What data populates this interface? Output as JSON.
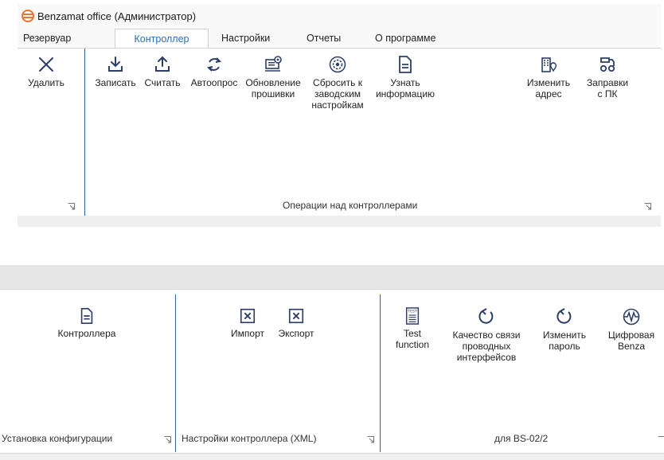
{
  "window": {
    "title": "Benzamat office (Администратор)"
  },
  "tabs": [
    {
      "label": "Резервуар",
      "active": false
    },
    {
      "label": "Контроллер",
      "active": true
    },
    {
      "label": "Настройки",
      "active": false
    },
    {
      "label": "Отчеты",
      "active": false
    },
    {
      "label": "О программе",
      "active": false
    }
  ],
  "ribbon_top": {
    "delete_label": "Удалить",
    "buttons": [
      {
        "label": "Записать",
        "icon": "download-icon"
      },
      {
        "label": "Считать",
        "icon": "upload-icon"
      },
      {
        "label": "Автоопрос",
        "icon": "refresh-icon"
      },
      {
        "label": "Обновление\nпрошивки",
        "icon": "firmware-icon"
      },
      {
        "label": "Сбросить к\nзаводским\nнастройкам",
        "icon": "factory-reset-icon"
      },
      {
        "label": "Узнать\nинформацию",
        "icon": "info-document-icon"
      },
      {
        "label": "Изменить\nадрес",
        "icon": "address-building-icon"
      },
      {
        "label": "Заправки\nс ПК",
        "icon": "fuel-dispenser-icon"
      }
    ],
    "group_label": "Операции над контроллерами"
  },
  "ribbon_bottom": {
    "groups": [
      {
        "label": "Установка конфигурации",
        "buttons": [
          {
            "label": "Контроллера",
            "icon": "document-icon"
          }
        ]
      },
      {
        "label": "Настройки контроллера (XML)",
        "buttons": [
          {
            "label": "Импорт",
            "icon": "xml-import-icon"
          },
          {
            "label": "Экспорт",
            "icon": "xml-export-icon"
          }
        ]
      },
      {
        "label": "для BS-02/2",
        "buttons": [
          {
            "label": "Test\nfunction",
            "icon": "test-checklist-icon"
          },
          {
            "label": "Качество связи\nпроводных\nинтерфейсов",
            "icon": "rotate-arrow-icon"
          },
          {
            "label": "Изменить\nпароль",
            "icon": "rotate-arrow-icon"
          },
          {
            "label": "Цифровая\nBenza",
            "icon": "signal-wave-icon"
          }
        ]
      }
    ]
  },
  "colors": {
    "accent": "#2a6ebb",
    "separator": "#3a5da8",
    "logo": "#e8762c"
  }
}
